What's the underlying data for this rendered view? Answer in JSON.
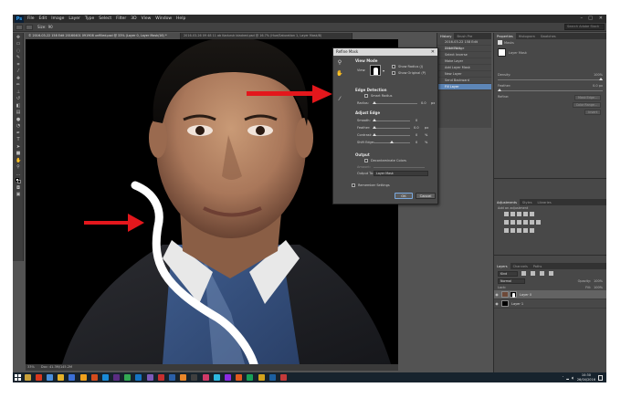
{
  "app": {
    "logo": "Ps",
    "menu": [
      "File",
      "Edit",
      "Image",
      "Layer",
      "Type",
      "Select",
      "Filter",
      "3D",
      "View",
      "Window",
      "Help"
    ],
    "window_controls": [
      "–",
      "□",
      "✕"
    ]
  },
  "options_bar": {
    "size_label": "Size:",
    "size_value": "90",
    "search_placeholder": "Search Adobe Stock"
  },
  "document_tabs": [
    {
      "label": "© 2016-03-22 158 Edit 20160401 091908 unfilled.psd @ 33% (Layer 0, Layer Mask/16) *",
      "active": true
    },
    {
      "label": "2016-03-26 09 48 11 ab Kaduruk blacked.psd @ 16.7% (Hue/Saturation 1, Layer Mask/8)",
      "active": false
    }
  ],
  "tools": [
    "move-icon",
    "marquee-icon",
    "lasso-icon",
    "quick-select-icon",
    "crop-icon",
    "eyedropper-icon",
    "heal-icon",
    "brush-icon",
    "stamp-icon",
    "history-brush-icon",
    "eraser-icon",
    "gradient-icon",
    "blur-icon",
    "dodge-icon",
    "pen-icon",
    "type-icon",
    "path-select-icon",
    "shape-icon",
    "hand-icon",
    "zoom-icon",
    "more-icon",
    "color-swatch-icon",
    "quickmask-icon",
    "screen-mode-icon"
  ],
  "history": {
    "tabs": [
      "History",
      "Brush Pre"
    ],
    "snapshot": "2016-03-22 158 Edit 20160401",
    "items": [
      {
        "label": "Color Range",
        "active": false
      },
      {
        "label": "Select Inverse",
        "active": false
      },
      {
        "label": "Make Layer",
        "active": false
      },
      {
        "label": "Add Layer Mask",
        "active": false
      },
      {
        "label": "New Layer",
        "active": false
      },
      {
        "label": "Send Backward",
        "active": false
      },
      {
        "label": "Fill Layer",
        "active": true
      }
    ]
  },
  "properties": {
    "tabs": [
      "Properties",
      "Histogram",
      "Swatches"
    ],
    "masks_label": "Masks",
    "layer_mask_label": "Layer Mask",
    "density_label": "Density:",
    "density_value": "100%",
    "feather_label": "Feather:",
    "feather_value": "0.0 px",
    "refine_label": "Refine:",
    "refine_buttons": [
      "Mask Edge...",
      "Color Range...",
      "Invert"
    ]
  },
  "adjustments": {
    "tabs": [
      "Adjustments",
      "Styles",
      "Libraries"
    ],
    "add_label": "Add an adjustment"
  },
  "layers": {
    "tabs": [
      "Layers",
      "Channels",
      "Paths"
    ],
    "kind_label": "Kind",
    "blend_mode": "Normal",
    "opacity_label": "Opacity:",
    "opacity_value": "100%",
    "lock_label": "Lock:",
    "fill_label": "Fill:",
    "fill_value": "100%",
    "rows": [
      {
        "name": "Layer 0",
        "active": true
      },
      {
        "name": "Layer 1",
        "active": false
      }
    ]
  },
  "refine_mask": {
    "title": "Refine Mask",
    "close_glyph": "✕",
    "view_mode_label": "View Mode",
    "view_label": "View:",
    "show_radius_label": "Show Radius (J)",
    "show_original_label": "Show Original (P)",
    "edge_detection_label": "Edge Detection",
    "smart_radius_label": "Smart Radius",
    "radius_label": "Radius:",
    "radius_value": "0.0",
    "radius_unit": "px",
    "adjust_edge_label": "Adjust Edge",
    "smooth_label": "Smooth:",
    "smooth_value": "0",
    "feather_label": "Feather:",
    "feather_value": "0.0",
    "feather_unit": "px",
    "contrast_label": "Contrast:",
    "contrast_value": "0",
    "contrast_unit": "%",
    "shift_edge_label": "Shift Edge:",
    "shift_edge_value": "0",
    "shift_edge_unit": "%",
    "output_label": "Output",
    "decontaminate_label": "Decontaminate Colors",
    "amount_label": "Amount:",
    "output_to_label": "Output To:",
    "output_to_value": "Layer Mask",
    "remember_label": "Remember Settings",
    "ok_label": "OK",
    "cancel_label": "Cancel"
  },
  "status_bar": {
    "zoom": "33%",
    "doc_info": "Doc: 41.3M/145.2M"
  },
  "taskbar": {
    "icons": [
      "#c9a13a",
      "#d9381e",
      "#4a8fdc",
      "#e5b128",
      "#3b6fd6",
      "#f0a01c",
      "#d34c1d",
      "#1a8ad6",
      "#5a2d82",
      "#32a852",
      "#1573c2",
      "#7d5ab8",
      "#c62f2f",
      "#2a5fa8",
      "#e8862a",
      "#3f3f3f",
      "#cf3a68",
      "#2db8e0",
      "#8a2be2",
      "#e05a1e",
      "#18a058",
      "#d2a21c",
      "#1c5fa0",
      "#c33a3a"
    ],
    "time": "10:30",
    "date": "26/04/2016"
  }
}
